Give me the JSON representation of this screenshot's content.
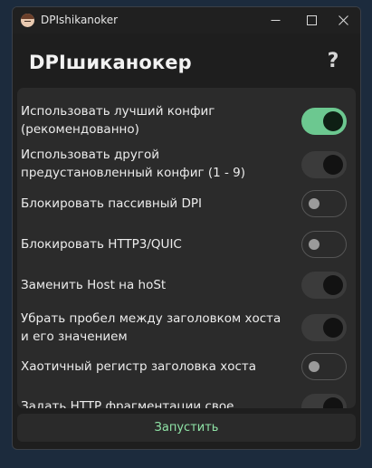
{
  "window": {
    "title": "DPIshikanoker",
    "icon": "app-avatar-icon",
    "controls": [
      "minimize-icon",
      "maximize-icon",
      "close-icon"
    ]
  },
  "header": {
    "title": "DPIшиканокер",
    "help_label": "?"
  },
  "options": [
    {
      "label": "Использовать лучший конфиг (рекомендованно)",
      "state": "on"
    },
    {
      "label": "Использовать другой предустановленный конфиг (1 - 9)",
      "state": "off-dark"
    },
    {
      "label": "Блокировать пассивный DPI",
      "state": "off"
    },
    {
      "label": "Блокировать HTTP3/QUIC",
      "state": "off"
    },
    {
      "label": "Заменить Host на hoSt",
      "state": "off-dark"
    },
    {
      "label": "Убрать пробел между заголовком хоста и его значением",
      "state": "off-dark"
    },
    {
      "label": "Хаотичный регистр заголовка хоста",
      "state": "off"
    },
    {
      "label": "Задать HTTP фрагментации свое значение",
      "state": "off-dark"
    }
  ],
  "footer": {
    "start_label": "Запустить"
  },
  "colors": {
    "accent": "#6cc890",
    "start_text": "#8fe3a6",
    "panel": "#2b2b2b",
    "window_bg": "#1e1e1e"
  }
}
